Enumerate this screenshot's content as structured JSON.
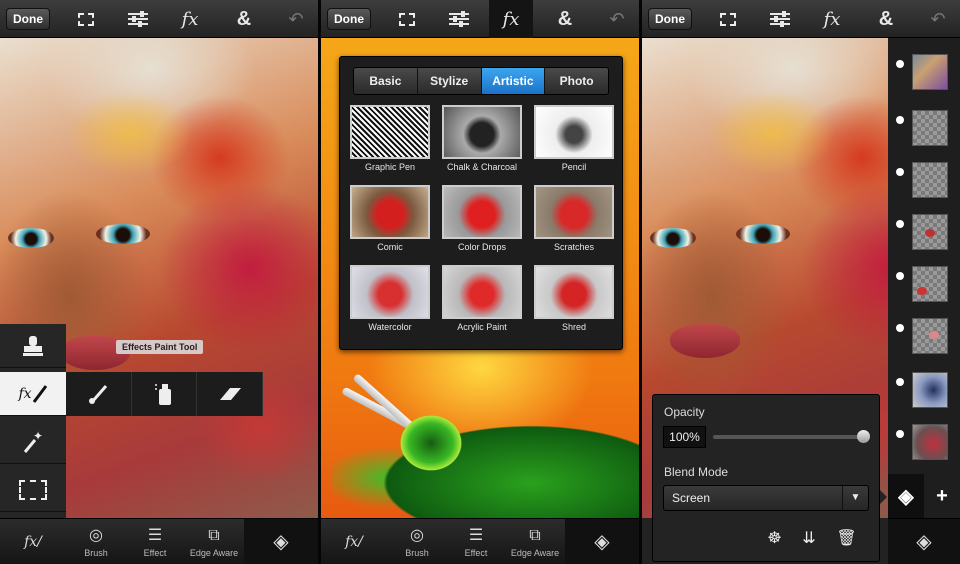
{
  "screens": [
    {
      "toolbar": {
        "done_label": "Done",
        "icons": [
          "selection-edit-icon",
          "adjustments-sliders-icon",
          "fx-icon",
          "ampersand-icon",
          "undo-icon"
        ],
        "fx_label": "fx",
        "amp_label": "&",
        "active": "none"
      },
      "tool_palette": {
        "tools": [
          "stamp-icon",
          "effects-paint-icon",
          "magic-wand-icon",
          "marquee-select-icon"
        ],
        "selected": "effects-paint-icon",
        "sub_tools": [
          "brush-icon",
          "spray-icon",
          "eraser-icon"
        ],
        "tooltip": "Effects Paint Tool"
      },
      "bottom_bar": {
        "items": [
          {
            "label": "",
            "icon": "effects-paint-icon"
          },
          {
            "label": "Brush",
            "icon": "brush-circle-icon"
          },
          {
            "label": "Effect",
            "icon": "effect-list-icon"
          },
          {
            "label": "Edge Aware",
            "icon": "edge-aware-icon"
          },
          {
            "label": "",
            "icon": "layers-add-icon"
          }
        ]
      }
    },
    {
      "toolbar": {
        "done_label": "Done",
        "icons": [
          "selection-edit-icon",
          "adjustments-sliders-icon",
          "fx-icon",
          "ampersand-icon",
          "undo-icon"
        ],
        "fx_label": "fx",
        "amp_label": "&",
        "active": "fx-icon"
      },
      "effects_panel": {
        "tabs": [
          "Basic",
          "Stylize",
          "Artistic",
          "Photo"
        ],
        "selected_tab": "Artistic",
        "effects": [
          "Graphic Pen",
          "Chalk & Charcoal",
          "Pencil",
          "Comic",
          "Color Drops",
          "Scratches",
          "Watercolor",
          "Acrylic Paint",
          "Shred"
        ]
      },
      "bottom_bar": {
        "items": [
          {
            "label": "",
            "icon": "effects-paint-icon"
          },
          {
            "label": "Brush",
            "icon": "brush-circle-icon"
          },
          {
            "label": "Effect",
            "icon": "effect-list-icon"
          },
          {
            "label": "Edge Aware",
            "icon": "edge-aware-icon"
          },
          {
            "label": "",
            "icon": "layers-add-icon"
          }
        ]
      }
    },
    {
      "toolbar": {
        "done_label": "Done",
        "icons": [
          "selection-edit-icon",
          "adjustments-sliders-icon",
          "fx-icon",
          "ampersand-icon",
          "undo-icon"
        ],
        "fx_label": "fx",
        "amp_label": "&",
        "active": "none"
      },
      "layers": {
        "count": 8,
        "add_label": "+"
      },
      "layer_properties": {
        "opacity_label": "Opacity",
        "opacity_value": "100%",
        "opacity_level": 1.0,
        "blend_mode_label": "Blend Mode",
        "blend_mode_value": "Screen",
        "actions": [
          "layer-effects-icon",
          "merge-layers-icon",
          "delete-layer-icon"
        ]
      },
      "bottom_bar": {
        "items": [
          {
            "label": "",
            "icon": "layers-add-icon"
          }
        ]
      }
    }
  ],
  "colors": {
    "accent_blue": "#2a8be0",
    "toolbar_bg": "#2c2c2c",
    "selected_tool_bg": "#f2f2f2"
  }
}
